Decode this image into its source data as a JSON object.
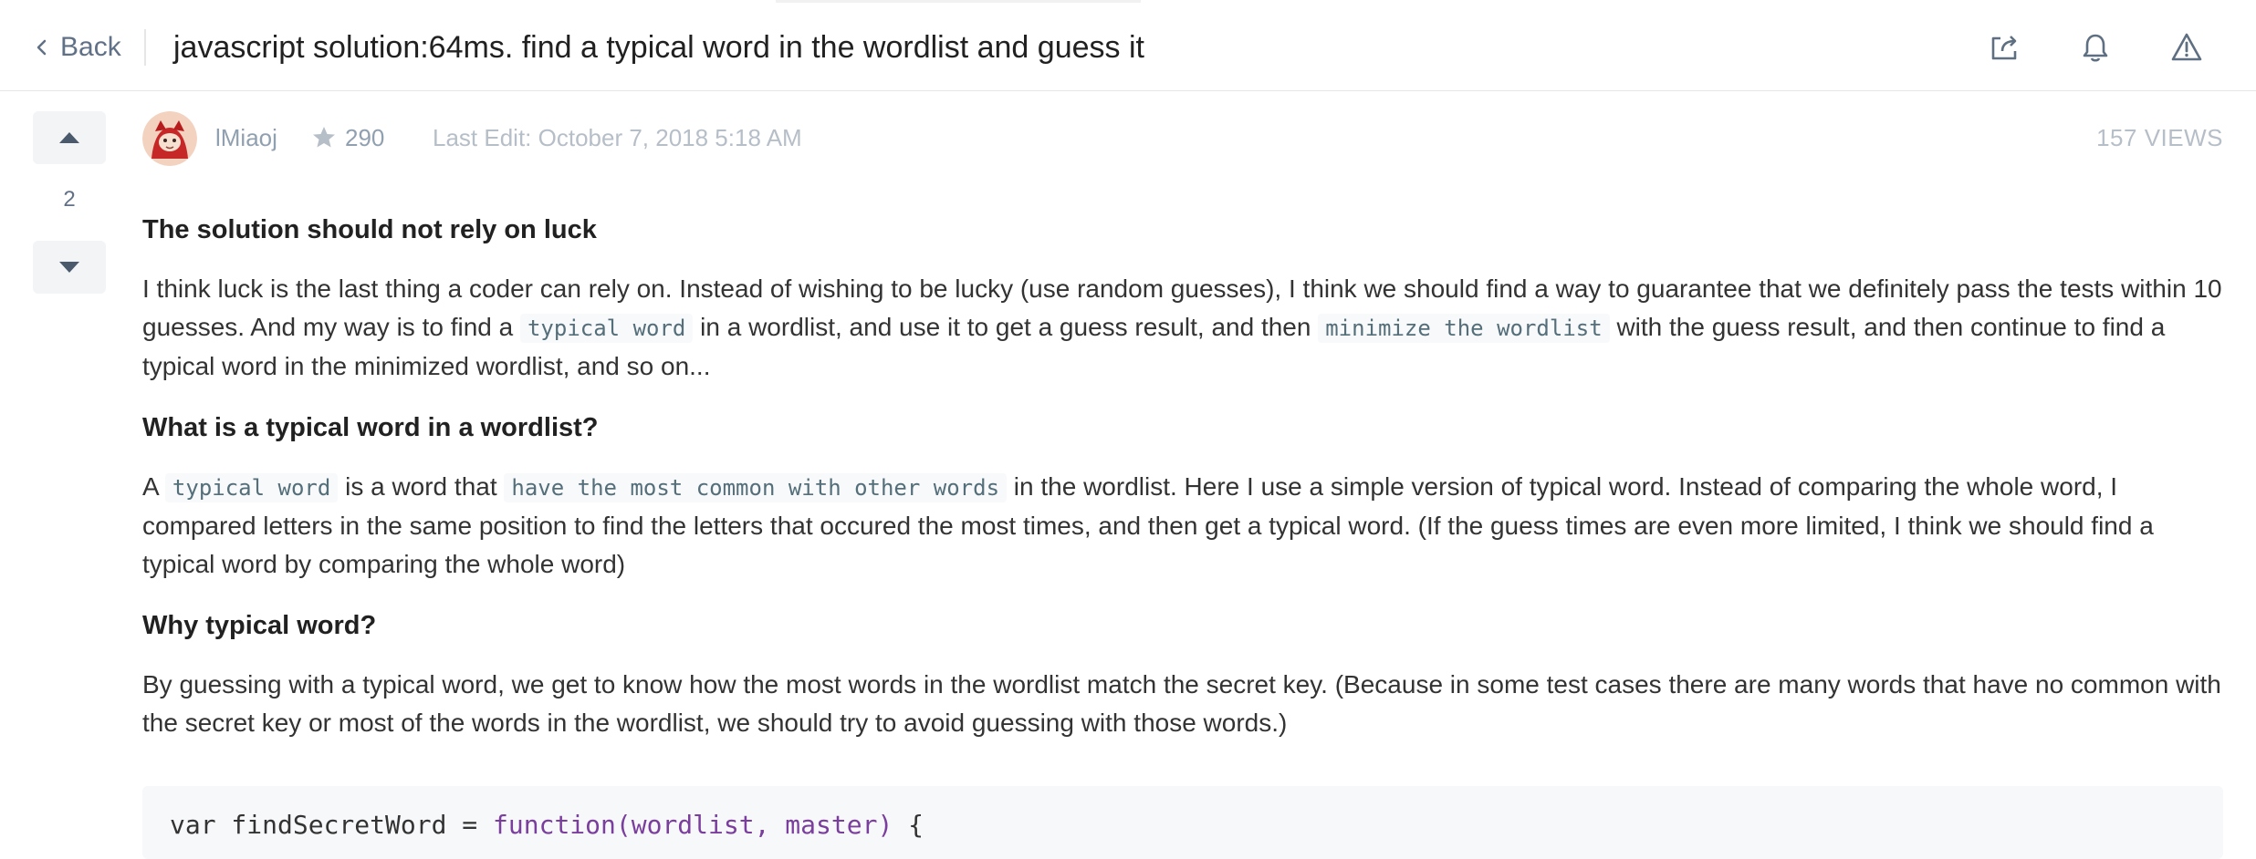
{
  "header": {
    "back_label": "Back",
    "title": "javascript solution:64ms. find a typical word in the wordlist and guess it",
    "icons": [
      "share-icon",
      "bell-icon",
      "warning-icon"
    ]
  },
  "vote": {
    "count": "2"
  },
  "meta": {
    "author": "lMiaoj",
    "reputation": "290",
    "last_edit": "Last Edit: October 7, 2018 5:18 AM",
    "views": "157 VIEWS"
  },
  "post": {
    "h1": "The solution should not rely on luck",
    "p1_a": "I think luck is the last thing a coder can rely on. Instead of wishing to be lucky (use random guesses), I think we should find a way to guarantee that we definitely pass the tests within 10 guesses. And my way is to find a ",
    "p1_code1": "typical word",
    "p1_b": " in a wordlist, and use it to get a guess result, and then ",
    "p1_code2": "minimize the wordlist",
    "p1_c": " with the guess result, and then continue to find a typical word in the minimized wordlist, and so on...",
    "h2": "What is a typical word in a wordlist?",
    "p2_a": "A ",
    "p2_code1": "typical word",
    "p2_b": " is a word that ",
    "p2_code2": "have the most common with other words",
    "p2_c": " in the wordlist. Here I use a simple version of typical word. Instead of comparing the whole word, I compared letters in the same position to find the letters that occured the most times, and then get a typical word. (If the guess times are even more limited, I think we should find a typical word by comparing the whole word)",
    "h3": "Why typical word?",
    "p3": "By guessing with a typical word, we get to know how the most words in the wordlist match the secret key. (Because in some test cases there are many words that have no common with the secret key or most of the words in the wordlist, we should try to avoid guessing with those words.)",
    "code_line_a": "var findSecretWord = ",
    "code_line_kw": "function(wordlist, master)",
    "code_line_b": " {"
  },
  "colors": {
    "accent_text": "#607086",
    "muted": "#b6bec8",
    "code_bg": "#f7f8fa",
    "keyword": "#7a3e9d"
  }
}
